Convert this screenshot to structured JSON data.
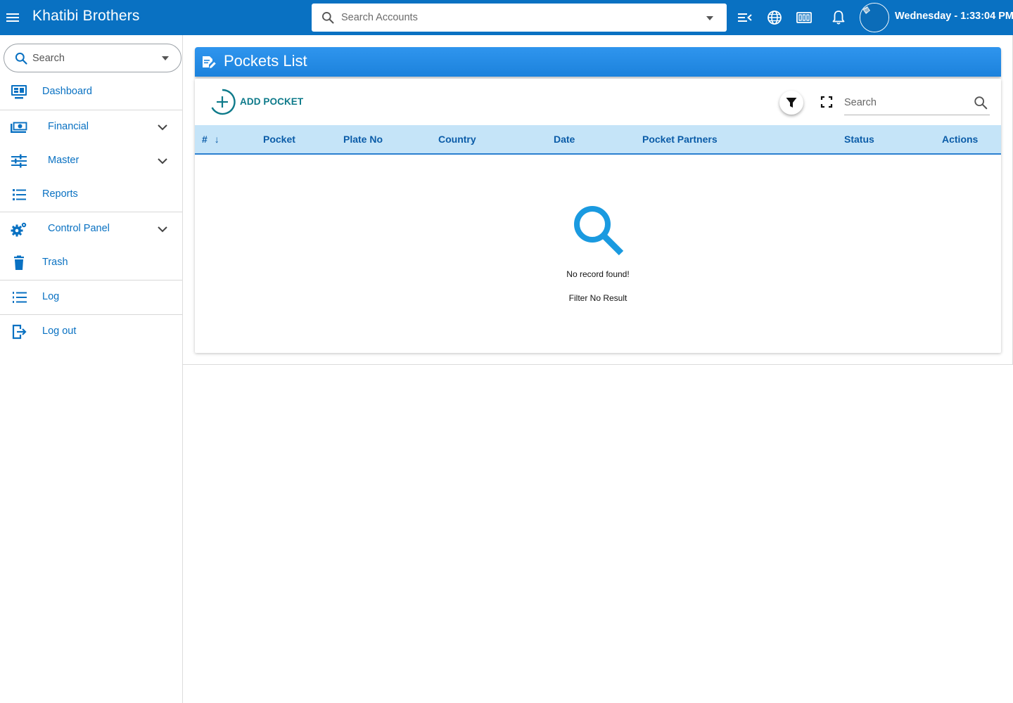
{
  "topbar": {
    "title": "Khatibi Brothers",
    "search_placeholder": "Search Accounts",
    "datetime": "Wednesday - 1:33:04 PM",
    "icons": [
      "menu-icon",
      "menu-collapse-icon",
      "globe-icon",
      "counter-icon",
      "bell-icon",
      "avatar"
    ]
  },
  "sidebar": {
    "search_placeholder": "Search",
    "items": [
      {
        "label": "Dashboard",
        "icon": "monitor-icon"
      },
      {
        "label": "Financial",
        "icon": "cash-icon",
        "expandable": true
      },
      {
        "label": "Master",
        "icon": "sliders-icon",
        "expandable": true
      },
      {
        "label": "Reports",
        "icon": "list-icon"
      },
      {
        "label": "Control Panel",
        "icon": "gears-icon",
        "expandable": true
      },
      {
        "label": "Trash",
        "icon": "trash-icon"
      },
      {
        "label": "Log",
        "icon": "ordered-list-icon"
      },
      {
        "label": "Log out",
        "icon": "logout-icon"
      }
    ]
  },
  "page": {
    "title": "Pockets List",
    "add_label": "ADD POCKET",
    "search_placeholder": "Search",
    "columns": [
      "#",
      "Pocket",
      "Plate No",
      "Country",
      "Date",
      "Pocket Partners",
      "Status",
      "Actions"
    ],
    "sort_indicator": "↓",
    "rows": [],
    "empty_title": "No record found!",
    "empty_subtitle": "Filter No Result"
  },
  "colors": {
    "brand": "#0971c2",
    "header_gradient_top": "#2f95ee",
    "table_header_bg": "#c5e4f8",
    "accent_teal": "#0e7a8a",
    "empty_icon": "#1a9ae0"
  }
}
